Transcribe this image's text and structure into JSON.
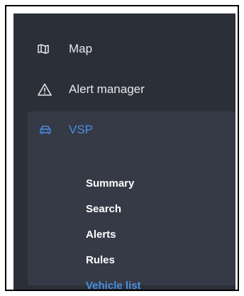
{
  "sidebar": {
    "items": [
      {
        "label": "Map",
        "icon": "map-icon"
      },
      {
        "label": "Alert manager",
        "icon": "warning-icon"
      }
    ],
    "vsp": {
      "label": "VSP",
      "icon": "car-icon",
      "active_color": "#4a90e2",
      "subitems": [
        {
          "label": "Summary"
        },
        {
          "label": "Search"
        },
        {
          "label": "Alerts"
        },
        {
          "label": "Rules"
        },
        {
          "label": "Vehicle list",
          "active": true
        }
      ]
    }
  }
}
